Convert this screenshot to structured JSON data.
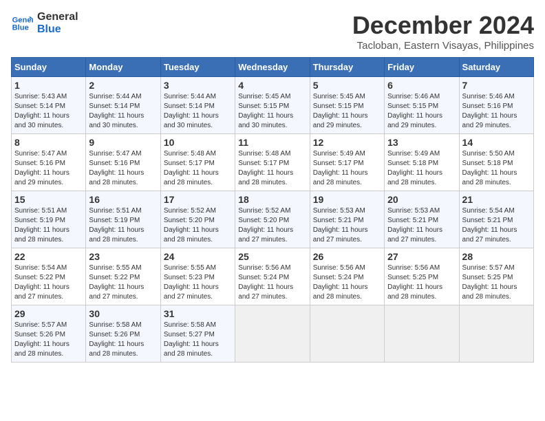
{
  "logo": {
    "line1": "General",
    "line2": "Blue"
  },
  "title": "December 2024",
  "subtitle": "Tacloban, Eastern Visayas, Philippines",
  "headers": [
    "Sunday",
    "Monday",
    "Tuesday",
    "Wednesday",
    "Thursday",
    "Friday",
    "Saturday"
  ],
  "weeks": [
    [
      {
        "day": "1",
        "info": "Sunrise: 5:43 AM\nSunset: 5:14 PM\nDaylight: 11 hours\nand 30 minutes."
      },
      {
        "day": "2",
        "info": "Sunrise: 5:44 AM\nSunset: 5:14 PM\nDaylight: 11 hours\nand 30 minutes."
      },
      {
        "day": "3",
        "info": "Sunrise: 5:44 AM\nSunset: 5:14 PM\nDaylight: 11 hours\nand 30 minutes."
      },
      {
        "day": "4",
        "info": "Sunrise: 5:45 AM\nSunset: 5:15 PM\nDaylight: 11 hours\nand 30 minutes."
      },
      {
        "day": "5",
        "info": "Sunrise: 5:45 AM\nSunset: 5:15 PM\nDaylight: 11 hours\nand 29 minutes."
      },
      {
        "day": "6",
        "info": "Sunrise: 5:46 AM\nSunset: 5:15 PM\nDaylight: 11 hours\nand 29 minutes."
      },
      {
        "day": "7",
        "info": "Sunrise: 5:46 AM\nSunset: 5:16 PM\nDaylight: 11 hours\nand 29 minutes."
      }
    ],
    [
      {
        "day": "8",
        "info": "Sunrise: 5:47 AM\nSunset: 5:16 PM\nDaylight: 11 hours\nand 29 minutes."
      },
      {
        "day": "9",
        "info": "Sunrise: 5:47 AM\nSunset: 5:16 PM\nDaylight: 11 hours\nand 28 minutes."
      },
      {
        "day": "10",
        "info": "Sunrise: 5:48 AM\nSunset: 5:17 PM\nDaylight: 11 hours\nand 28 minutes."
      },
      {
        "day": "11",
        "info": "Sunrise: 5:48 AM\nSunset: 5:17 PM\nDaylight: 11 hours\nand 28 minutes."
      },
      {
        "day": "12",
        "info": "Sunrise: 5:49 AM\nSunset: 5:17 PM\nDaylight: 11 hours\nand 28 minutes."
      },
      {
        "day": "13",
        "info": "Sunrise: 5:49 AM\nSunset: 5:18 PM\nDaylight: 11 hours\nand 28 minutes."
      },
      {
        "day": "14",
        "info": "Sunrise: 5:50 AM\nSunset: 5:18 PM\nDaylight: 11 hours\nand 28 minutes."
      }
    ],
    [
      {
        "day": "15",
        "info": "Sunrise: 5:51 AM\nSunset: 5:19 PM\nDaylight: 11 hours\nand 28 minutes."
      },
      {
        "day": "16",
        "info": "Sunrise: 5:51 AM\nSunset: 5:19 PM\nDaylight: 11 hours\nand 28 minutes."
      },
      {
        "day": "17",
        "info": "Sunrise: 5:52 AM\nSunset: 5:20 PM\nDaylight: 11 hours\nand 28 minutes."
      },
      {
        "day": "18",
        "info": "Sunrise: 5:52 AM\nSunset: 5:20 PM\nDaylight: 11 hours\nand 27 minutes."
      },
      {
        "day": "19",
        "info": "Sunrise: 5:53 AM\nSunset: 5:21 PM\nDaylight: 11 hours\nand 27 minutes."
      },
      {
        "day": "20",
        "info": "Sunrise: 5:53 AM\nSunset: 5:21 PM\nDaylight: 11 hours\nand 27 minutes."
      },
      {
        "day": "21",
        "info": "Sunrise: 5:54 AM\nSunset: 5:21 PM\nDaylight: 11 hours\nand 27 minutes."
      }
    ],
    [
      {
        "day": "22",
        "info": "Sunrise: 5:54 AM\nSunset: 5:22 PM\nDaylight: 11 hours\nand 27 minutes."
      },
      {
        "day": "23",
        "info": "Sunrise: 5:55 AM\nSunset: 5:22 PM\nDaylight: 11 hours\nand 27 minutes."
      },
      {
        "day": "24",
        "info": "Sunrise: 5:55 AM\nSunset: 5:23 PM\nDaylight: 11 hours\nand 27 minutes."
      },
      {
        "day": "25",
        "info": "Sunrise: 5:56 AM\nSunset: 5:24 PM\nDaylight: 11 hours\nand 27 minutes."
      },
      {
        "day": "26",
        "info": "Sunrise: 5:56 AM\nSunset: 5:24 PM\nDaylight: 11 hours\nand 28 minutes."
      },
      {
        "day": "27",
        "info": "Sunrise: 5:56 AM\nSunset: 5:25 PM\nDaylight: 11 hours\nand 28 minutes."
      },
      {
        "day": "28",
        "info": "Sunrise: 5:57 AM\nSunset: 5:25 PM\nDaylight: 11 hours\nand 28 minutes."
      }
    ],
    [
      {
        "day": "29",
        "info": "Sunrise: 5:57 AM\nSunset: 5:26 PM\nDaylight: 11 hours\nand 28 minutes."
      },
      {
        "day": "30",
        "info": "Sunrise: 5:58 AM\nSunset: 5:26 PM\nDaylight: 11 hours\nand 28 minutes."
      },
      {
        "day": "31",
        "info": "Sunrise: 5:58 AM\nSunset: 5:27 PM\nDaylight: 11 hours\nand 28 minutes."
      },
      null,
      null,
      null,
      null
    ]
  ]
}
